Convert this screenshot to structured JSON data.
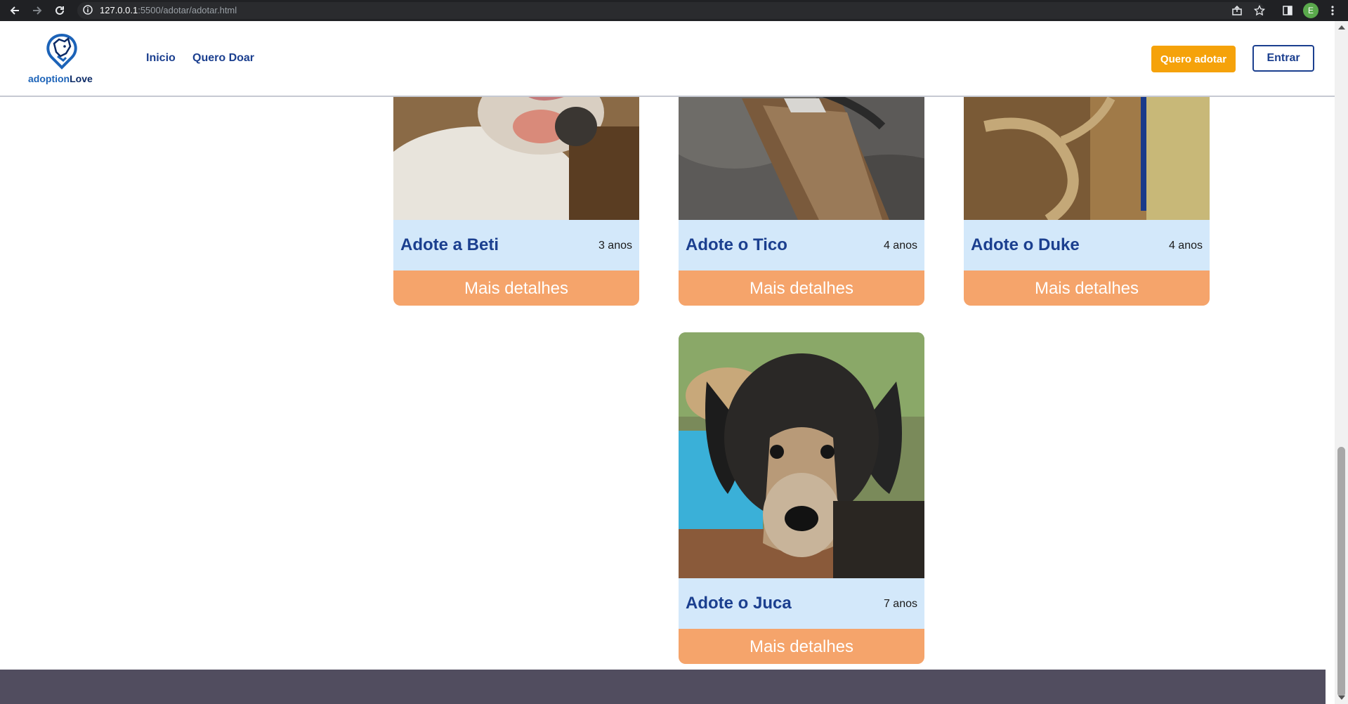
{
  "browser": {
    "url_host": "127.0.0.1",
    "url_rest": ":5500/adotar/adotar.html",
    "profile_initial": "E"
  },
  "header": {
    "logo_text_part1": "adoption",
    "logo_text_part2": "Love",
    "nav": [
      "Inicio",
      "Quero Doar"
    ],
    "cta_primary": "Quero adotar",
    "cta_secondary": "Entrar"
  },
  "cards": [
    {
      "name": "Adote a Beti",
      "age": "3 anos",
      "button": "Mais detalhes",
      "photo": "dog-beti"
    },
    {
      "name": "Adote o Tico",
      "age": "4 anos",
      "button": "Mais detalhes",
      "photo": "bird-tico"
    },
    {
      "name": "Adote o Duke",
      "age": "4 anos",
      "button": "Mais detalhes",
      "photo": "parrot-duke"
    },
    {
      "name": "Adote o Juca",
      "age": "7 anos",
      "button": "Mais detalhes",
      "photo": "dog-juca"
    }
  ],
  "colors": {
    "brand_blue": "#1b3f8f",
    "accent_orange": "#f5a20a",
    "card_info_bg": "#d3e8fa",
    "card_button_bg": "#f5a46b",
    "footer_bg": "#514d5f"
  }
}
